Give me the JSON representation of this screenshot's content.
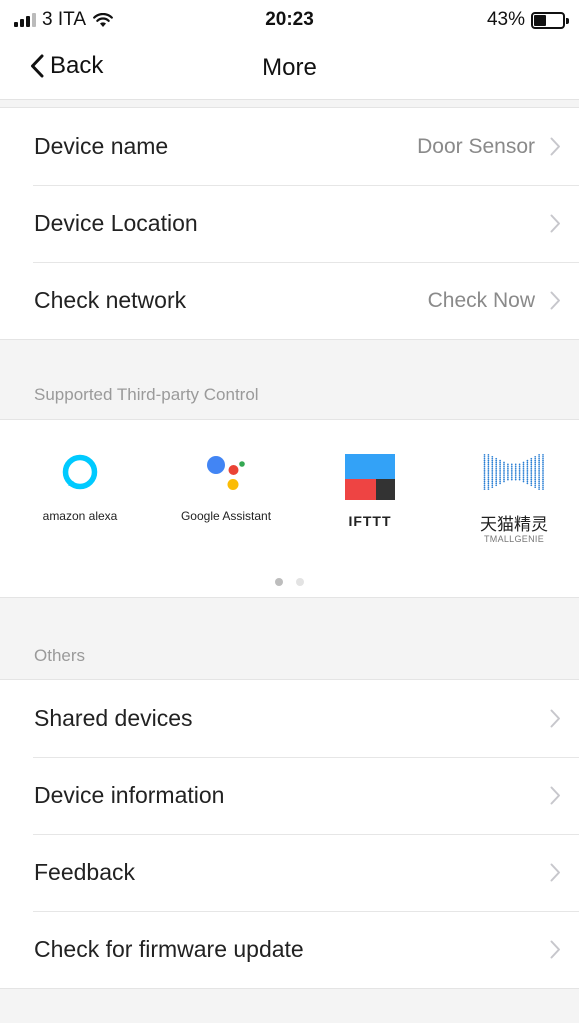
{
  "status_bar": {
    "carrier": "3 ITA",
    "time": "20:23",
    "battery_percent_text": "43%",
    "battery_level": 0.43,
    "signal_icon": "cellular-signal-icon",
    "wifi_icon": "wifi-icon",
    "battery_icon": "battery-icon"
  },
  "nav": {
    "back_label": "Back",
    "title": "More",
    "back_icon": "chevron-left-icon"
  },
  "device_settings": [
    {
      "label": "Device name",
      "value": "Door Sensor"
    },
    {
      "label": "Device Location",
      "value": ""
    },
    {
      "label": "Check network",
      "value": "Check Now"
    }
  ],
  "third_party": {
    "header": "Supported Third-party Control",
    "items": [
      {
        "name": "amazon alexa",
        "icon": "alexa-logo-icon"
      },
      {
        "name": "Google Assistant",
        "icon": "google-assistant-logo-icon"
      },
      {
        "name": "IFTTT",
        "icon": "ifttt-logo-icon"
      },
      {
        "name": "天猫精灵",
        "subname": "TMALLGENIE",
        "icon": "tmall-genie-logo-icon"
      }
    ],
    "page_indicator": {
      "pages": 2,
      "current": 1
    }
  },
  "others": {
    "header": "Others",
    "items": [
      {
        "label": "Shared devices"
      },
      {
        "label": "Device information"
      },
      {
        "label": "Feedback"
      },
      {
        "label": "Check for firmware update"
      }
    ]
  },
  "colors": {
    "background": "#f4f4f4",
    "card": "#ffffff",
    "secondary_text": "#8a8a8a",
    "chevron": "#c7c7cc",
    "alexa": "#00caff",
    "ifttt_blue": "#33a2f7",
    "ifttt_red": "#ee4443",
    "dot_active": "#bdbdbd",
    "dot_inactive": "#e3e3e3"
  }
}
